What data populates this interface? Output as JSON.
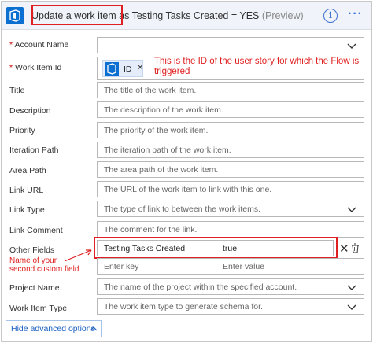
{
  "header": {
    "title_main": "Update a work item as Testing Tasks Created = YES",
    "title_preview": " (Preview)"
  },
  "icons": {
    "app": "azure-devops-icon",
    "info": "info-icon",
    "more": "more-options-icon",
    "token": "azure-devops-token-icon",
    "remove_row": "close-icon",
    "delete_row": "trash-icon",
    "dropdown": "chevron-down-icon",
    "collapse": "chevron-up-icon"
  },
  "fields": {
    "account_name": {
      "label": "Account Name",
      "value": ""
    },
    "work_item_id": {
      "label": "Work Item Id",
      "token": "ID"
    },
    "title": {
      "label": "Title",
      "placeholder": "The title of the work item."
    },
    "description": {
      "label": "Description",
      "placeholder": "The description of the work item."
    },
    "priority": {
      "label": "Priority",
      "placeholder": "The priority of the work item."
    },
    "iteration_path": {
      "label": "Iteration Path",
      "placeholder": "The iteration path of the work item."
    },
    "area_path": {
      "label": "Area Path",
      "placeholder": "The area path of the work item."
    },
    "link_url": {
      "label": "Link URL",
      "placeholder": "The URL of the work item to link with this one."
    },
    "link_type": {
      "label": "Link Type",
      "placeholder": "The type of link to between the work items."
    },
    "link_comment": {
      "label": "Link Comment",
      "placeholder": "The comment for the link."
    },
    "other_fields": {
      "label": "Other Fields",
      "key": "Testing Tasks Created",
      "value": "true",
      "key_placeholder": "Enter key",
      "value_placeholder": "Enter value"
    },
    "project_name": {
      "label": "Project Name",
      "placeholder": "The name of the project within the specified account."
    },
    "work_item_type": {
      "label": "Work Item Type",
      "placeholder": "The work item type to generate schema for."
    }
  },
  "required_marker": "*",
  "annotations": {
    "id_note": "This is the ID of the user story for which the Flow is triggered",
    "custom_field_note": "Name of your second custom field"
  },
  "footer": {
    "advanced_label": "Hide advanced options"
  },
  "colors": {
    "accent": "#0a6fd0",
    "annotation": "#e02020",
    "link": "#1a5fc0"
  }
}
